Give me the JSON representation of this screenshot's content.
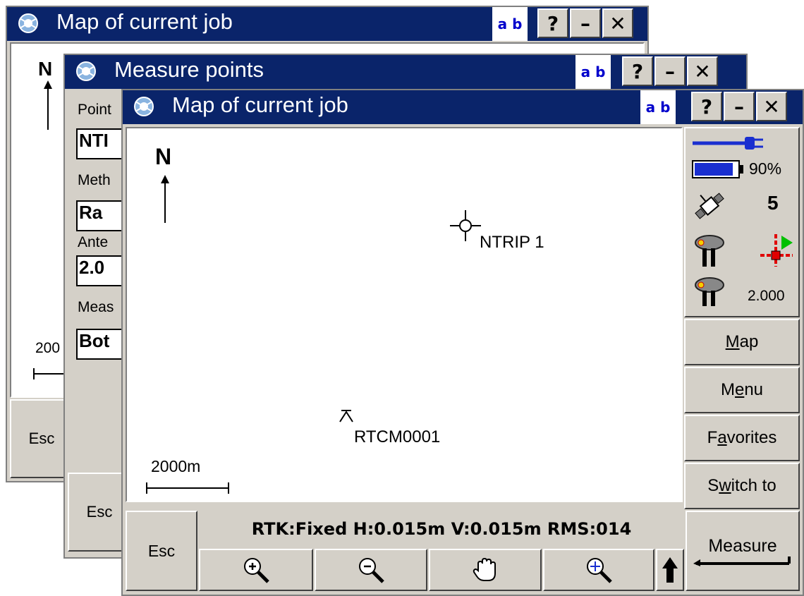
{
  "back_window": {
    "title": "Map of current job",
    "ab_label": "a b",
    "help_label": "?",
    "minimize_label": "–",
    "close_label": "✕",
    "north_label": "N",
    "scale_label": "200",
    "esc_label": "Esc"
  },
  "middle_window": {
    "title": "Measure points",
    "ab_label": "a b",
    "help_label": "?",
    "minimize_label": "–",
    "close_label": "✕",
    "labels": {
      "point": "Point",
      "method": "Meth",
      "antenna": "Ante",
      "measure": "Meas"
    },
    "values": {
      "point": "NTI",
      "method": "Ra",
      "antenna": "2.0",
      "measure": "Bot"
    },
    "esc_label": "Esc"
  },
  "front_window": {
    "title": "Map of current job",
    "ab_label": "a b",
    "help_label": "?",
    "minimize_label": "–",
    "close_label": "✕",
    "map": {
      "north_label": "N",
      "point1_label": "NTRIP 1",
      "point2_label": "RTCM0001",
      "scale_label": "2000m"
    },
    "status": {
      "battery_percent": "90%",
      "battery_level": 0.9,
      "satellites": "5",
      "antenna_height": "2.000"
    },
    "side_buttons": {
      "map": {
        "pre": "",
        "key": "M",
        "post": "ap"
      },
      "menu": {
        "pre": "M",
        "key": "e",
        "post": "nu"
      },
      "favorites": {
        "pre": "F",
        "key": "a",
        "post": "vorites"
      },
      "switch_to": {
        "pre": "S",
        "key": "w",
        "post": "itch to"
      }
    },
    "status_bar": "RTK:Fixed H:0.015m V:0.015m RMS:014",
    "esc_label": "Esc",
    "measure_label": "Measure",
    "toolbar_icons": [
      "zoom-in-icon",
      "zoom-out-icon",
      "pan-hand-icon",
      "zoom-extents-icon",
      "up-arrow-icon"
    ]
  }
}
